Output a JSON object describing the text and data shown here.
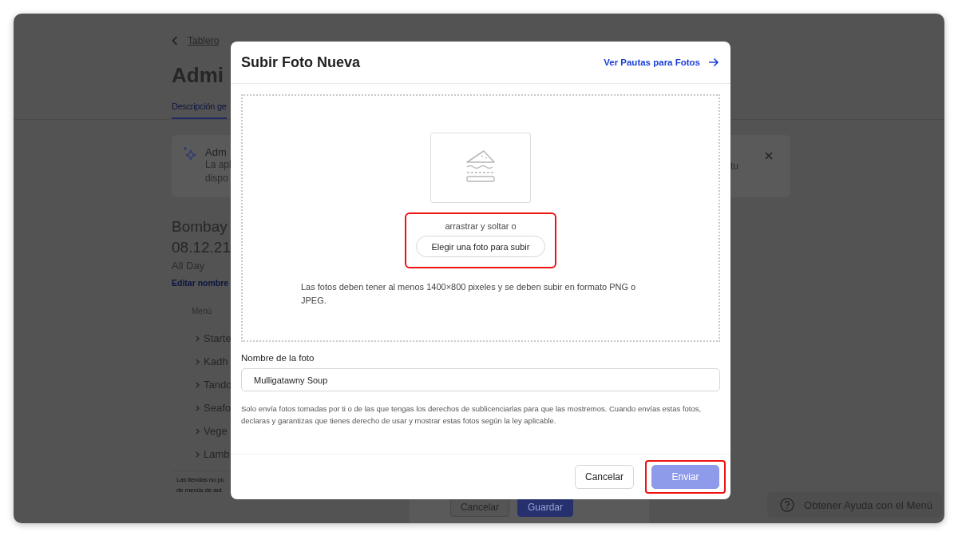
{
  "page": {
    "back_link": "Tablero",
    "title": "Admi",
    "tabs": [
      {
        "label": "Descripción ge",
        "selected": true
      }
    ],
    "notice": {
      "title": "Adm",
      "lines": [
        "La apl",
        "dispo"
      ],
      "tail": "tu"
    },
    "menu_name": "Bombay",
    "date": "08.12.21",
    "hours": "All Day",
    "edit_link": "Editar nombre",
    "menu": {
      "heading": "Menú",
      "categories": [
        "Starte",
        "Kadh",
        "Tando",
        "Seafo",
        "Vege",
        "Lamb"
      ],
      "footnote": [
        "Las tiendas no pu",
        "de menús de aut"
      ]
    },
    "bottom_bar": {
      "buttons": [
        {
          "label": "Cancelar",
          "kind": "secondary"
        },
        {
          "label": "Guardar",
          "kind": "primary"
        }
      ]
    }
  },
  "modal": {
    "title": "Subir Foto Nueva",
    "guidelines_link": "Ver Pautas para Fotos",
    "dropzone": {
      "prompt": "arrastrar y soltar o",
      "choose_button": "Elegir una foto para subir",
      "highlighted": true,
      "requirements": "Las fotos deben tener al menos 1400×800 pixeles y se deben subir en formato PNG o JPEG."
    },
    "name_field": {
      "label": "Nombre de la foto",
      "value": "Mulligatawny Soup"
    },
    "disclaimer": "Solo envía fotos tomadas por ti o de las que tengas los derechos de sublicenciarlas para que las mostremos. Cuando envías estas fotos, declaras y garantizas que tienes derecho de usar y mostrar estas fotos según la ley aplicable.",
    "buttons": [
      {
        "label": "Cancelar",
        "kind": "secondary",
        "disabled": false,
        "highlighted": false
      },
      {
        "label": "Enviar",
        "kind": "primary",
        "disabled": true,
        "highlighted": true
      }
    ]
  },
  "help_button": "Obtener Ayuda con el Menú"
}
